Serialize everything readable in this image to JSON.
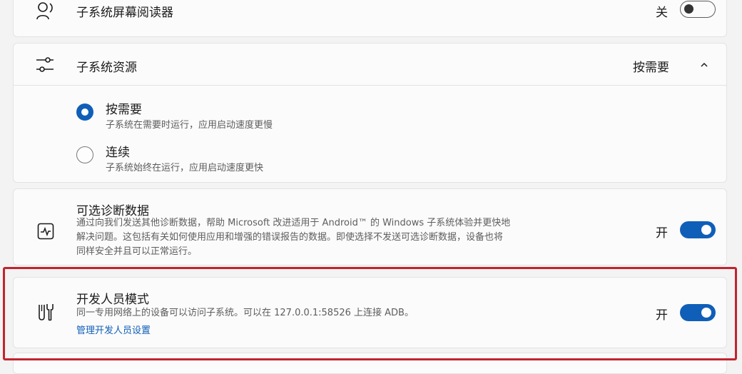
{
  "screen_reader": {
    "title": "子系统屏幕阅读器",
    "state_label": "关",
    "toggle_on": false
  },
  "resources": {
    "title": "子系统资源",
    "current_value": "按需要",
    "options": [
      {
        "label": "按需要",
        "description": "子系统在需要时运行，应用启动速度更慢",
        "selected": true
      },
      {
        "label": "连续",
        "description": "子系统始终在运行，应用启动速度更快",
        "selected": false
      }
    ]
  },
  "diagnostics": {
    "title": "可选诊断数据",
    "description_lines": [
      "通过向我们发送其他诊断数据，帮助 Microsoft 改进适用于 Android™ 的 Windows 子系统体验并更快地",
      "解决问题。这包括有关如何使用应用和增强的错误报告的数据。即使选择不发送可选诊断数据，设备也将",
      "同样安全并且可以正常运行。"
    ],
    "state_label": "开",
    "toggle_on": true
  },
  "developer_mode": {
    "title": "开发人员模式",
    "description": "同一专用网络上的设备可以访问子系统。可以在 127.0.0.1:58526 上连接 ADB。",
    "link": "管理开发人员设置",
    "state_label": "开",
    "toggle_on": true,
    "icon": "tools-icon"
  },
  "colors": {
    "accent": "#0f5fb8",
    "highlight_border": "#c2232f"
  }
}
